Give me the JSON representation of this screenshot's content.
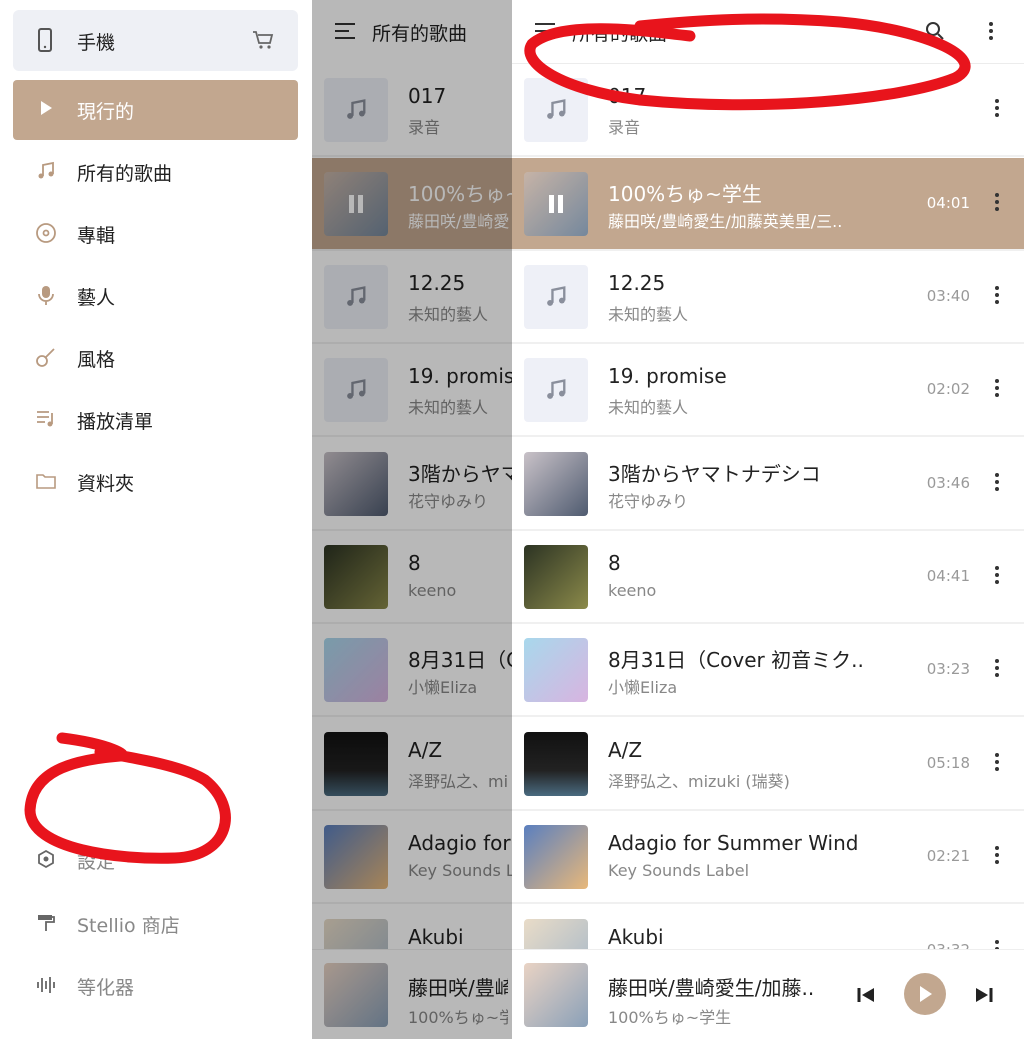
{
  "drawer": {
    "device": {
      "label": "手機",
      "icon": "phone-icon",
      "badge_icon": "shopping-cart-icon"
    },
    "items": [
      {
        "label": "現行的",
        "icon": "play-icon",
        "active": true
      },
      {
        "label": "所有的歌曲",
        "icon": "music-note-icon"
      },
      {
        "label": "專輯",
        "icon": "disc-icon"
      },
      {
        "label": "藝人",
        "icon": "microphone-icon"
      },
      {
        "label": "風格",
        "icon": "guitar-icon"
      },
      {
        "label": "播放清單",
        "icon": "playlist-icon"
      },
      {
        "label": "資料夾",
        "icon": "folder-icon"
      }
    ],
    "bottom_items": [
      {
        "label": "設定",
        "icon": "settings-icon"
      },
      {
        "label": "Stellio 商店",
        "icon": "paint-roller-icon"
      },
      {
        "label": "等化器",
        "icon": "equalizer-icon"
      }
    ]
  },
  "header": {
    "title": "所有的歌曲",
    "menu_icon": "menu-icon",
    "search_icon": "search-icon",
    "more_icon": "more-vert-icon"
  },
  "songs": [
    {
      "title": "017",
      "artist": "录音",
      "duration": ""
    },
    {
      "title": "100%ちゅ~学生",
      "artist": "藤田咲/豊崎愛生/加藤英美里/三..",
      "duration": "04:01",
      "playing": true
    },
    {
      "title": "12.25",
      "artist": "未知的藝人",
      "duration": "03:40"
    },
    {
      "title": "19. promise",
      "artist": "未知的藝人",
      "duration": "02:02"
    },
    {
      "title": "3階からヤマトナデシコ",
      "artist": "花守ゆみり",
      "duration": "03:46"
    },
    {
      "title": "8",
      "artist": "keeno",
      "duration": "04:41"
    },
    {
      "title": "8月31日（Cover 初音ミク..",
      "artist": "小懒Eliza",
      "duration": "03:23"
    },
    {
      "title": "A/Z",
      "artist": "泽野弘之、mizuki (瑞葵)",
      "duration": "05:18"
    },
    {
      "title": "Adagio for Summer Wind",
      "artist": "Key Sounds Label",
      "duration": "02:21"
    },
    {
      "title": "Akubi",
      "artist": "",
      "duration": "03:32"
    }
  ],
  "overlay_rows": [
    {
      "title": "017",
      "artist": "录音"
    },
    {
      "title": "100%ちゅ~学",
      "artist": "藤田咲/豊崎愛"
    },
    {
      "title": "12.25",
      "artist": "未知的藝人"
    },
    {
      "title": "19. promise",
      "artist": "未知的藝人"
    },
    {
      "title": "3階からヤマ",
      "artist": "花守ゆみり"
    },
    {
      "title": "8",
      "artist": "keeno"
    },
    {
      "title": "8月31日（C",
      "artist": "小懒Eliza"
    },
    {
      "title": "A/Z",
      "artist": "泽野弘之、mi"
    },
    {
      "title": "Adagio for",
      "artist": "Key Sounds L"
    },
    {
      "title": "Akubi",
      "artist": ""
    }
  ],
  "overlay_player": {
    "title": "藤田咲/豊崎",
    "subtitle": "100%ちゅ~学"
  },
  "player": {
    "title": "藤田咲/豊崎愛生/加藤..",
    "subtitle": "100%ちゅ~学生",
    "prev_icon": "skip-previous-icon",
    "play_icon": "play-icon",
    "next_icon": "skip-next-icon"
  },
  "colors": {
    "accent": "#c2a78f",
    "annotation": "#e8141c"
  }
}
